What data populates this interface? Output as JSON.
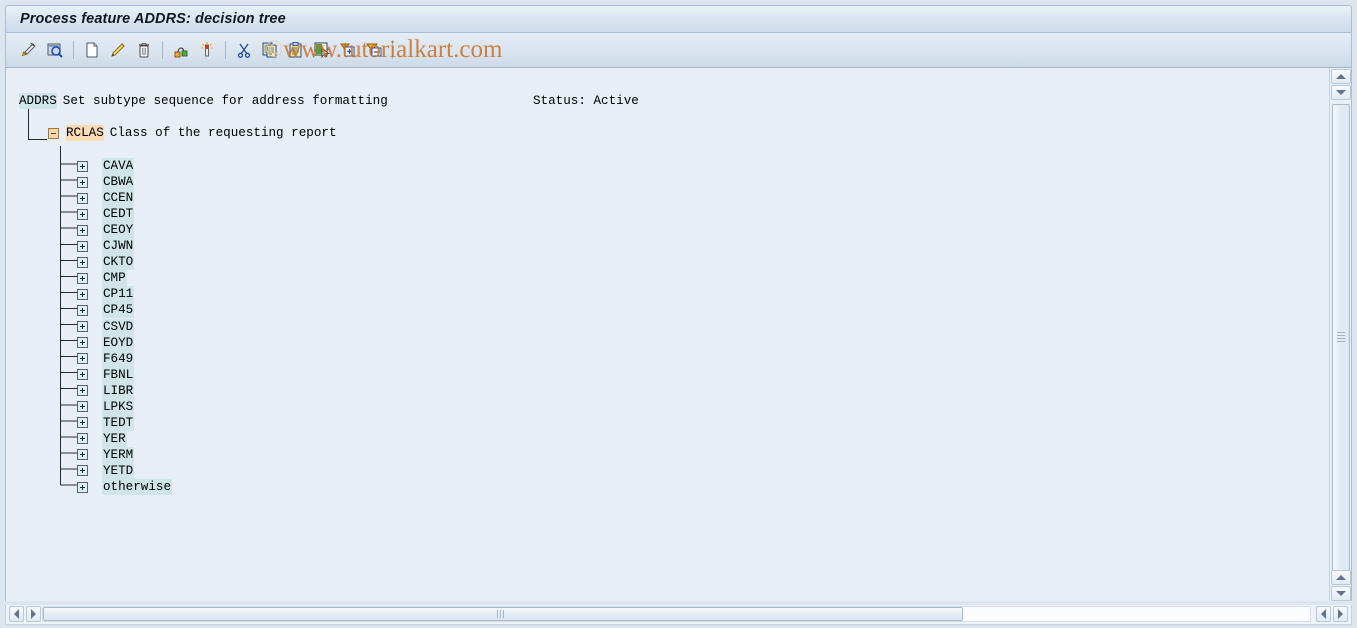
{
  "window": {
    "title": "Process feature ADDRS: decision tree"
  },
  "watermark": {
    "text": "www.tutorialkart.com",
    "copyright": "©",
    "color": "#c9742a"
  },
  "toolbar": {
    "items": [
      {
        "name": "check-pencil-icon",
        "tooltip": "Check"
      },
      {
        "name": "display-search-icon",
        "tooltip": "Display"
      },
      {
        "name": "new-document-icon",
        "tooltip": "Create"
      },
      {
        "name": "edit-pencil-icon",
        "tooltip": "Change"
      },
      {
        "name": "delete-trash-icon",
        "tooltip": "Delete"
      },
      {
        "name": "node-link-icon",
        "tooltip": "Node"
      },
      {
        "name": "magic-wand-icon",
        "tooltip": "Generate"
      },
      {
        "name": "cut-scissors-icon",
        "tooltip": "Cut"
      },
      {
        "name": "copy-icon",
        "tooltip": "Copy"
      },
      {
        "name": "paste-clipboard-icon",
        "tooltip": "Paste"
      },
      {
        "name": "select-insert-icon",
        "tooltip": "Select"
      },
      {
        "name": "expand-all-icon",
        "tooltip": "Expand all"
      },
      {
        "name": "collapse-all-icon",
        "tooltip": "Collapse all"
      }
    ]
  },
  "tree": {
    "root": {
      "code": "ADDRS",
      "description": "Set subtype sequence for address formatting",
      "status_label": "Status: Active"
    },
    "field": {
      "code": "RCLAS",
      "description": "Class of the requesting report"
    },
    "children": [
      {
        "label": "CAVA"
      },
      {
        "label": "CBWA"
      },
      {
        "label": "CCEN"
      },
      {
        "label": "CEDT"
      },
      {
        "label": "CEOY"
      },
      {
        "label": "CJWN"
      },
      {
        "label": "CKTO"
      },
      {
        "label": "CMP"
      },
      {
        "label": "CP11"
      },
      {
        "label": "CP45"
      },
      {
        "label": "CSVD"
      },
      {
        "label": "EOYD"
      },
      {
        "label": "F649"
      },
      {
        "label": "FBNL"
      },
      {
        "label": "LIBR"
      },
      {
        "label": "LPKS"
      },
      {
        "label": "TEDT"
      },
      {
        "label": "YER"
      },
      {
        "label": "YERM"
      },
      {
        "label": "YETD"
      },
      {
        "label": "otherwise"
      }
    ]
  },
  "colors": {
    "highlight_cyan": "#cfe5e8",
    "highlight_orange": "#f8dcb4",
    "content_background": "#e7eef6",
    "chrome_background": "#dde6ee"
  },
  "scrollbars": {
    "vertical": {
      "up_icon": "triangle-up-icon",
      "down_icon": "triangle-down-icon"
    },
    "horizontal": {
      "left_icon": "triangle-left-icon",
      "right_icon": "triangle-right-icon"
    }
  }
}
